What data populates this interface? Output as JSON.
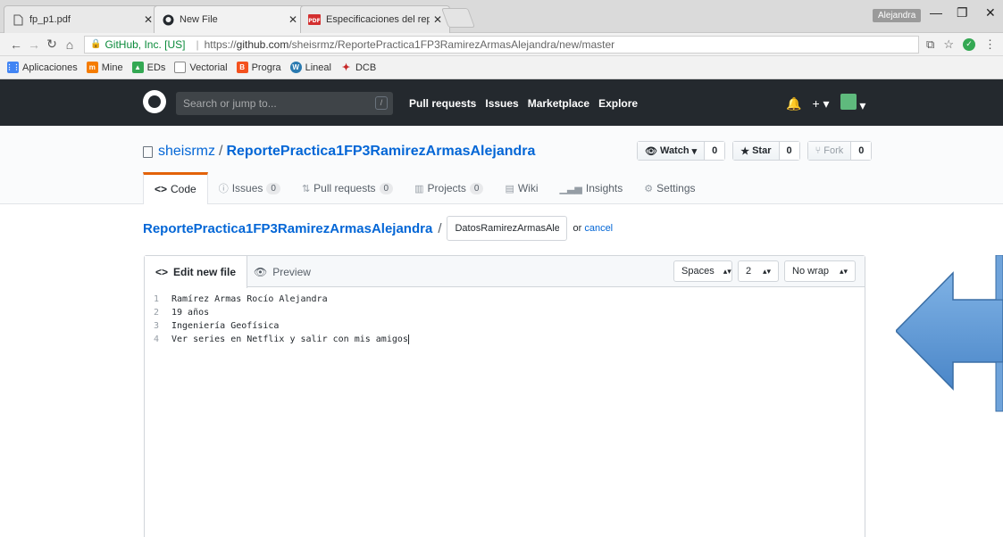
{
  "browser": {
    "tabs": [
      {
        "title": "fp_p1.pdf",
        "icon": "document-icon"
      },
      {
        "title": "New File",
        "icon": "github-icon"
      },
      {
        "title": "Especificaciones del repo",
        "icon": "pdf-icon"
      }
    ],
    "user_label": "Alejandra",
    "address": {
      "secure_label": "GitHub, Inc. [US]",
      "url_scheme": "https://",
      "url_host": "github.com",
      "url_path": "/sheisrmz/ReportePractica1FP3RamirezArmasAlejandra/new/master"
    },
    "bookmarks": [
      {
        "label": "Aplicaciones",
        "color": "#4285f4"
      },
      {
        "label": "Mine",
        "color": "#f57c00"
      },
      {
        "label": "EDs",
        "color": "#34a853"
      },
      {
        "label": "Vectorial",
        "color": "#888888"
      },
      {
        "label": "Progra",
        "color": "#f4511e"
      },
      {
        "label": "Lineal",
        "color": "#2a7ab0"
      },
      {
        "label": "DCB",
        "color": "#c62828"
      }
    ]
  },
  "github": {
    "search_placeholder": "Search or jump to...",
    "search_key": "/",
    "nav": [
      "Pull requests",
      "Issues",
      "Marketplace",
      "Explore"
    ],
    "owner": "sheisrmz",
    "repo": "ReportePractica1FP3RamirezArmasAlejandra",
    "watch_label": "Watch",
    "watch_count": "0",
    "star_label": "Star",
    "star_count": "0",
    "fork_label": "Fork",
    "fork_count": "0",
    "reponav": [
      {
        "label": "Code",
        "count": ""
      },
      {
        "label": "Issues",
        "count": "0"
      },
      {
        "label": "Pull requests",
        "count": "0"
      },
      {
        "label": "Projects",
        "count": "0"
      },
      {
        "label": "Wiki",
        "count": ""
      },
      {
        "label": "Insights",
        "count": ""
      },
      {
        "label": "Settings",
        "count": ""
      }
    ],
    "breadcrumb_sep": "/",
    "filename_value": "DatosRamirezArmasAlej",
    "or_text": "or",
    "cancel_label": "cancel"
  },
  "editor": {
    "tab_edit": "Edit new file",
    "tab_preview": "Preview",
    "indent_mode": "Spaces",
    "indent_size": "2",
    "wrap_mode": "No wrap",
    "lines": [
      {
        "n": "1",
        "text": "Ramírez Armas Rocío Alejandra"
      },
      {
        "n": "2",
        "text": "19 años"
      },
      {
        "n": "3",
        "text": "Ingeniería Geofísica"
      },
      {
        "n": "4",
        "text": "Ver series en Netflix y salir con mis amigos"
      }
    ]
  },
  "annotation": {
    "arrow_color": "#5b9bd5"
  }
}
